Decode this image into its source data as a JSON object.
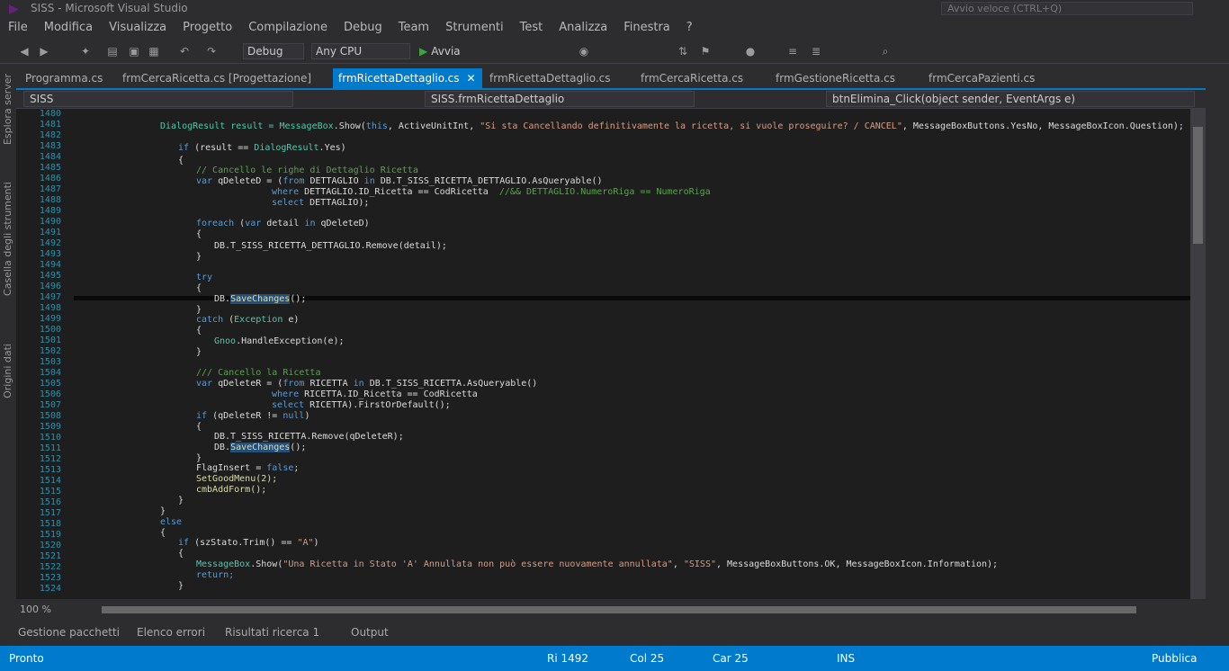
{
  "window": {
    "title": "SISS - Microsoft Visual Studio",
    "quick_launch": "Avvio veloce (CTRL+Q)"
  },
  "menu": [
    "File",
    "Modifica",
    "Visualizza",
    "Progetto",
    "Compilazione",
    "Debug",
    "Team",
    "Strumenti",
    "Test",
    "Analizza",
    "Finestra",
    "?"
  ],
  "toolbar": {
    "config": "Debug",
    "platform": "Any CPU",
    "run_label": "Avvia"
  },
  "left_panels": [
    "Esplora server",
    "Casella degli strumenti",
    "Origini dati"
  ],
  "tabs": [
    {
      "label": "Programma.cs",
      "active": false
    },
    {
      "label": "frmCercaRicetta.cs [Progettazione]",
      "active": false
    },
    {
      "label": "frmRicettaDettaglio.cs",
      "active": true
    },
    {
      "label": "frmRicettaDettaglio.cs",
      "active": false
    },
    {
      "label": "frmCercaRicetta.cs",
      "active": false
    },
    {
      "label": "frmGestioneRicetta.cs",
      "active": false
    },
    {
      "label": "frmCercaPazienti.cs",
      "active": false
    }
  ],
  "navbar": {
    "project": "SISS",
    "class": "SISS.frmRicettaDettaglio",
    "member": "btnElimina_Click(object sender, EventArgs e)"
  },
  "line_numbers": [
    "1480",
    "1481",
    "1482",
    "1483",
    "1484",
    "1485",
    "1486",
    "1487",
    "1488",
    "1489",
    "1490",
    "1491",
    "1492",
    "1493",
    "1494",
    "1495",
    "1496",
    "1497",
    "1498",
    "1499",
    "1500",
    "1501",
    "1502",
    "1503",
    "1504",
    "1505",
    "1506",
    "1507",
    "1508",
    "1509",
    "1510",
    "1511",
    "1512",
    "1513",
    "1514",
    "1515",
    "1516",
    "1517",
    "1518",
    "1519",
    "1520",
    "1521",
    "1522",
    "1523",
    "1524"
  ],
  "code": {
    "l1a": "DialogResult result = ",
    "l1b": "MessageBox",
    "l1c": ".Show(",
    "l1d": "this",
    "l1e": ", ActiveUnitInt, ",
    "l1f": "\"Si sta Cancellando definitivamente la ricetta, si vuole proseguire? / CANCEL\"",
    "l1g": ", MessageBoxButtons.YesNo, MessageBoxIcon.Question);",
    "l2a": "if",
    "l2b": " (result == ",
    "l2c": "DialogResult",
    "l2d": ".Yes)",
    "l4": "// Cancello le righe di Dettaglio Ricetta",
    "l5a": "var",
    "l5b": " qDeleteD = (",
    "l5c": "from",
    "l5d": " DETTAGLIO ",
    "l5e": "in",
    "l5f": " DB.T_SISS_RICETTA_DETTAGLIO.AsQueryable()",
    "l6a": "where",
    "l6b": " DETTAGLIO.ID_Ricetta == ",
    "l6c": "CodRicetta",
    "l6d": "  //&& DETTAGLIO.NumeroRiga == NumeroRiga",
    "l7a": "select",
    "l7b": " DETTAGLIO);",
    "l8a": "foreach",
    "l8b": " (",
    "l8c": "var",
    "l8d": " detail ",
    "l8e": "in",
    "l8f": " qDeleteD)",
    "l10": "DB.T_SISS_RICETTA_DETTAGLIO.Remove(detail);",
    "l12": "try",
    "l14a": "DB.",
    "l14b": "SaveChanges",
    "l14c": "();",
    "l16a": "catch",
    "l16b": " (",
    "l16c": "Exception",
    "l16d": " e)",
    "l18a": "Gnoo",
    "l18b": ".HandleException(e);",
    "l20": "/// Cancello la Ricetta",
    "l21a": "var",
    "l21b": " qDeleteR = (",
    "l21c": "from",
    "l21d": " RICETTA ",
    "l21e": "in",
    "l21f": " DB.T_SISS_RICETTA.AsQueryable()",
    "l22a": "where",
    "l22b": " RICETTA.ID_Ricetta == CodRicetta",
    "l23a": "select",
    "l23b": " RICETTA).FirstOrDefault();",
    "l24a": "if",
    "l24b": " (qDeleteR != ",
    "l24c": "null",
    "l24d": ")",
    "l26": "DB.T_SISS_RICETTA.Remove(qDeleteR);",
    "l27a": "DB.",
    "l27b": "SaveChanges",
    "l27c": "();",
    "l29a": "FlagInsert",
    "l29b": " = ",
    "l29c": "false",
    "l29d": ";",
    "l30": "SetGoodMenu(2);",
    "l31": "cmbAddForm();",
    "l34": "else",
    "l36a": "if",
    "l36b": " (",
    "l36c": "szStato",
    "l36d": ".Trim() == ",
    "l36e": "\"A\"",
    "l36f": ")",
    "l38a": "MessageBox",
    "l38b": ".Show(",
    "l38c": "\"Una Ricetta in Stato 'A' Annullata non può essere nuovamente annullata\"",
    "l38d": ", ",
    "l38e": "\"SISS\"",
    "l38f": ", MessageBoxButtons.OK, MessageBoxIcon.Information);",
    "l39": "return;"
  },
  "editor": {
    "zoom": "100 %"
  },
  "bottom_tabs": [
    "Gestione pacchetti",
    "Elenco errori",
    "Risultati ricerca 1",
    "Output"
  ],
  "status": {
    "left": "Pronto",
    "line": "Ri 1492",
    "col": "Col 25",
    "car": "Car 25",
    "ins": "INS",
    "right": "Pubblica"
  },
  "colors": {
    "accent": "#007acc",
    "editor_bg": "#1e1e1e",
    "chrome_bg": "#2d2d30"
  }
}
